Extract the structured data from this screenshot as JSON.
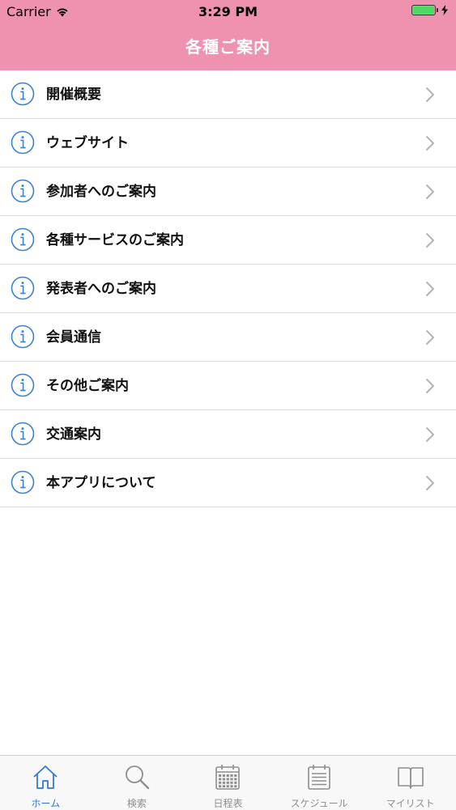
{
  "status_bar": {
    "carrier": "Carrier",
    "time": "3:29 PM"
  },
  "nav": {
    "title": "各種ご案内"
  },
  "menu": {
    "items": [
      {
        "label": "開催概要",
        "icon": "info-icon"
      },
      {
        "label": "ウェブサイト",
        "icon": "info-icon"
      },
      {
        "label": "参加者へのご案内",
        "icon": "info-icon"
      },
      {
        "label": "各種サービスのご案内",
        "icon": "info-icon"
      },
      {
        "label": "発表者へのご案内",
        "icon": "info-icon"
      },
      {
        "label": "会員通信",
        "icon": "info-icon"
      },
      {
        "label": "その他ご案内",
        "icon": "info-icon"
      },
      {
        "label": "交通案内",
        "icon": "info-icon"
      },
      {
        "label": "本アプリについて",
        "icon": "info-icon"
      }
    ]
  },
  "tabbar": {
    "active_index": 0,
    "tabs": [
      {
        "label": "ホーム",
        "icon": "home-icon"
      },
      {
        "label": "検索",
        "icon": "search-icon"
      },
      {
        "label": "日程表",
        "icon": "calendar-icon"
      },
      {
        "label": "スケジュール",
        "icon": "schedule-icon"
      },
      {
        "label": "マイリスト",
        "icon": "book-icon"
      }
    ]
  },
  "colors": {
    "accent": "#ee92b0",
    "info_icon": "#3a82d4",
    "tab_active": "#3478d6",
    "tab_inactive": "#8e8e8e",
    "chevron": "#b3b3b3"
  }
}
